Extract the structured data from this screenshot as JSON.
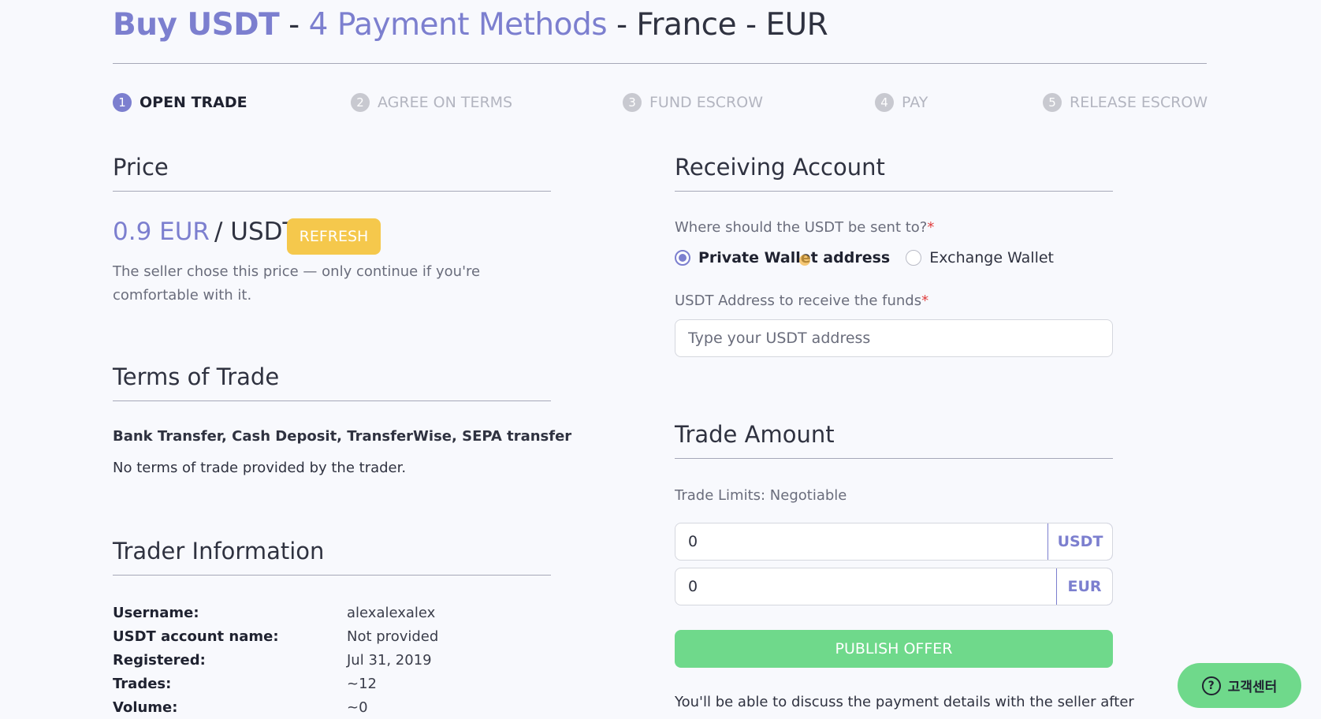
{
  "header": {
    "title_buy": "Buy USDT",
    "sep1": " - ",
    "title_methods": "4 Payment Methods",
    "sep2": " - ",
    "title_country": "France - EUR"
  },
  "steps": [
    {
      "num": "1",
      "label": "OPEN TRADE",
      "active": true
    },
    {
      "num": "2",
      "label": "AGREE ON TERMS",
      "active": false
    },
    {
      "num": "3",
      "label": "FUND ESCROW",
      "active": false
    },
    {
      "num": "4",
      "label": "PAY",
      "active": false
    },
    {
      "num": "5",
      "label": "RELEASE ESCROW",
      "active": false
    }
  ],
  "price": {
    "heading": "Price",
    "amount": "0.9 EUR",
    "unit": "/ USDT",
    "refresh_label": "REFRESH",
    "note": "The seller chose this price — only continue if you're comfortable with it."
  },
  "terms": {
    "heading": "Terms of Trade",
    "methods": "Bank Transfer, Cash Deposit, TransferWise, SEPA transfer",
    "text": "No terms of trade provided by the trader."
  },
  "trader": {
    "heading": "Trader Information",
    "rows": [
      {
        "label": "Username:",
        "value": "alexalexalex"
      },
      {
        "label": "USDT account name:",
        "value": "Not provided"
      },
      {
        "label": "Registered:",
        "value": "Jul 31, 2019"
      },
      {
        "label": "Trades:",
        "value": "~12"
      },
      {
        "label": "Volume:",
        "value": "~0"
      }
    ]
  },
  "receiving": {
    "heading": "Receiving Account",
    "question": "Where should the USDT be sent to?",
    "required_mark": "*",
    "option_private": "Private Wallet address",
    "option_exchange": "Exchange Wallet",
    "address_label": "USDT Address to receive the funds",
    "address_placeholder": "Type your USDT address"
  },
  "trade_amount": {
    "heading": "Trade Amount",
    "limits": "Trade Limits: Negotiable",
    "usdt_value": "0",
    "usdt_currency": "USDT",
    "eur_value": "0",
    "eur_currency": "EUR",
    "publish_label": "PUBLISH OFFER",
    "note": "You'll be able to discuss the payment details with the seller after"
  },
  "help": {
    "icon": "?",
    "label": "고객센터"
  },
  "colors": {
    "accent": "#7c7fcf",
    "refresh": "#f5c84c",
    "publish": "#6fd98b",
    "required": "#e03e3e"
  }
}
